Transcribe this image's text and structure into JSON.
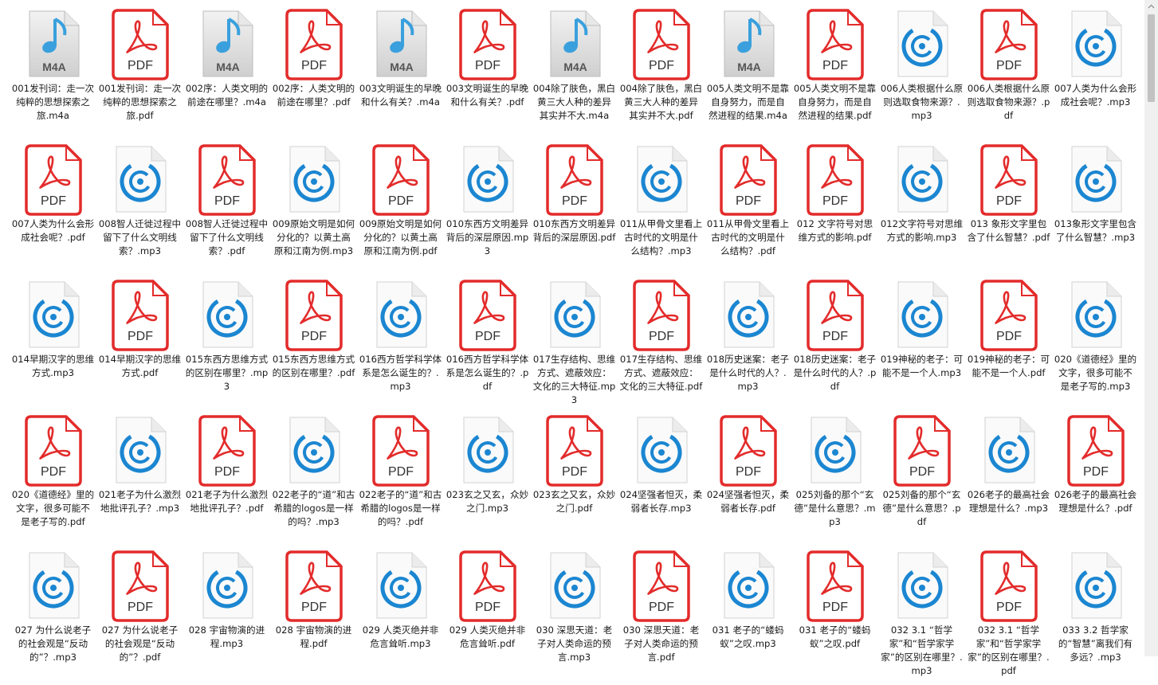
{
  "colors": {
    "pdf_red": "#e32b2b",
    "m4a_blue": "#3aa0dd",
    "mp3_blue": "#1b86d1",
    "doc_grey": "#dcdcdc"
  },
  "files": [
    {
      "type": "m4a",
      "name": "001发刊词：走一次纯粹的思想探索之旅.m4a"
    },
    {
      "type": "pdf",
      "name": "001发刊词：走一次纯粹的思想探索之旅.pdf"
    },
    {
      "type": "m4a",
      "name": "002序：人类文明的前途在哪里？.m4a"
    },
    {
      "type": "pdf",
      "name": "002序：人类文明的前途在哪里？.pdf"
    },
    {
      "type": "m4a",
      "name": "003文明诞生的早晚和什么有关？.m4a"
    },
    {
      "type": "pdf",
      "name": "003文明诞生的早晚和什么有关？.pdf"
    },
    {
      "type": "m4a",
      "name": "004除了肤色，黑白黄三大人种的差异其实并不大.m4a"
    },
    {
      "type": "pdf",
      "name": "004除了肤色，黑白黄三大人种的差异其实并不大.pdf"
    },
    {
      "type": "m4a",
      "name": "005人类文明不是靠自身努力，而是自然进程的结果.m4a"
    },
    {
      "type": "pdf",
      "name": "005人类文明不是靠自身努力，而是自然进程的结果.pdf"
    },
    {
      "type": "mp3",
      "name": "006人类根据什么原则选取食物来源？.mp3"
    },
    {
      "type": "pdf",
      "name": "006人类根据什么原则选取食物来源？.pdf"
    },
    {
      "type": "mp3",
      "name": "007人类为什么会形成社会呢？.mp3"
    },
    {
      "type": "pdf",
      "name": "007人类为什么会形成社会呢？.pdf"
    },
    {
      "type": "mp3",
      "name": "008智人迁徙过程中留下了什么文明线索？.mp3"
    },
    {
      "type": "pdf",
      "name": "008智人迁徙过程中留下了什么文明线索？.pdf"
    },
    {
      "type": "mp3",
      "name": "009原始文明是如何分化的？以黄土高原和江南为例.mp3"
    },
    {
      "type": "pdf",
      "name": "009原始文明是如何分化的？以黄土高原和江南为例.pdf"
    },
    {
      "type": "mp3",
      "name": "010东西方文明差异背后的深层原因.mp3"
    },
    {
      "type": "pdf",
      "name": "010东西方文明差异背后的深层原因.pdf"
    },
    {
      "type": "mp3",
      "name": "011从甲骨文里看上古时代的文明是什么结构？.mp3"
    },
    {
      "type": "pdf",
      "name": "011从甲骨文里看上古时代的文明是什么结构？.pdf"
    },
    {
      "type": "pdf",
      "name": "012 文字符号对思维方式的影响.pdf"
    },
    {
      "type": "mp3",
      "name": "012文字符号对思维方式的影响.mp3"
    },
    {
      "type": "pdf",
      "name": "013 象形文字里包含了什么智慧？.pdf"
    },
    {
      "type": "mp3",
      "name": "013象形文字里包含了什么智慧？.mp3"
    },
    {
      "type": "mp3",
      "name": "014早期汉字的思维方式.mp3"
    },
    {
      "type": "pdf",
      "name": "014早期汉字的思维方式.pdf"
    },
    {
      "type": "mp3",
      "name": "015东西方思维方式的区别在哪里？.mp3"
    },
    {
      "type": "pdf",
      "name": "015东西方思维方式的区别在哪里？.pdf"
    },
    {
      "type": "mp3",
      "name": "016西方哲学科学体系是怎么诞生的？.mp3"
    },
    {
      "type": "pdf",
      "name": "016西方哲学科学体系是怎么诞生的？.pdf"
    },
    {
      "type": "mp3",
      "name": "017生存结构、思维方式、遮蔽效应：文化的三大特征.mp3"
    },
    {
      "type": "pdf",
      "name": "017生存结构、思维方式、遮蔽效应：文化的三大特征.pdf"
    },
    {
      "type": "mp3",
      "name": "018历史迷案：老子是什么时代的人？.mp3"
    },
    {
      "type": "pdf",
      "name": "018历史迷案：老子是什么时代的人？.pdf"
    },
    {
      "type": "mp3",
      "name": "019神秘的老子：可能不是一个人.mp3"
    },
    {
      "type": "pdf",
      "name": "019神秘的老子：可能不是一个人.pdf"
    },
    {
      "type": "mp3",
      "name": "020《道德经》里的文字，很多可能不是老子写的.mp3"
    },
    {
      "type": "pdf",
      "name": "020《道德经》里的文字，很多可能不是老子写的.pdf"
    },
    {
      "type": "mp3",
      "name": "021老子为什么激烈地批评孔子？.mp3"
    },
    {
      "type": "pdf",
      "name": "021老子为什么激烈地批评孔子？.pdf"
    },
    {
      "type": "mp3",
      "name": "022老子的“道”和古希腊的logos是一样的吗？.mp3"
    },
    {
      "type": "pdf",
      "name": "022老子的“道”和古希腊的logos是一样的吗？.pdf"
    },
    {
      "type": "mp3",
      "name": "023玄之又玄，众妙之门.mp3"
    },
    {
      "type": "pdf",
      "name": "023玄之又玄，众妙之门.pdf"
    },
    {
      "type": "mp3",
      "name": "024坚强者怛灭，柔弱者长存.mp3"
    },
    {
      "type": "pdf",
      "name": "024坚强者怛灭，柔弱者长存.pdf"
    },
    {
      "type": "mp3",
      "name": "025刘备的那个“玄德”是什么意思？.mp3"
    },
    {
      "type": "pdf",
      "name": "025刘备的那个“玄德”是什么意思？.pdf"
    },
    {
      "type": "mp3",
      "name": "026老子的最高社会理想是什么？.mp3"
    },
    {
      "type": "pdf",
      "name": "026老子的最高社会理想是什么？.pdf"
    },
    {
      "type": "mp3",
      "name": "027 为什么说老子的社会观是“反动的”？.mp3"
    },
    {
      "type": "pdf",
      "name": "027 为什么说老子的社会观是“反动的”？.pdf"
    },
    {
      "type": "mp3",
      "name": "028 宇宙物演的进程.mp3"
    },
    {
      "type": "pdf",
      "name": "028 宇宙物演的进程.pdf"
    },
    {
      "type": "mp3",
      "name": "029 人类灭绝并非危言耸听.mp3"
    },
    {
      "type": "pdf",
      "name": "029 人类灭绝并非危言耸听.pdf"
    },
    {
      "type": "mp3",
      "name": "030 深思天道：老子对人类命运的预言.mp3"
    },
    {
      "type": "pdf",
      "name": "030 深思天道：老子对人类命运的预言.pdf"
    },
    {
      "type": "mp3",
      "name": "031 老子的“蝼蚂蚁”之叹.mp3"
    },
    {
      "type": "pdf",
      "name": "031 老子的“蝼蚂蚁”之叹.pdf"
    },
    {
      "type": "mp3",
      "name": "032 3.1 “哲学家”和“哲学家学家”的区别在哪里？.mp3"
    },
    {
      "type": "pdf",
      "name": "032 3.1 “哲学家”和“哲学家学家”的区别在哪里？.pdf"
    },
    {
      "type": "mp3",
      "name": "033 3.2 哲学家的“智慧”离我们有多远？.mp3"
    }
  ]
}
